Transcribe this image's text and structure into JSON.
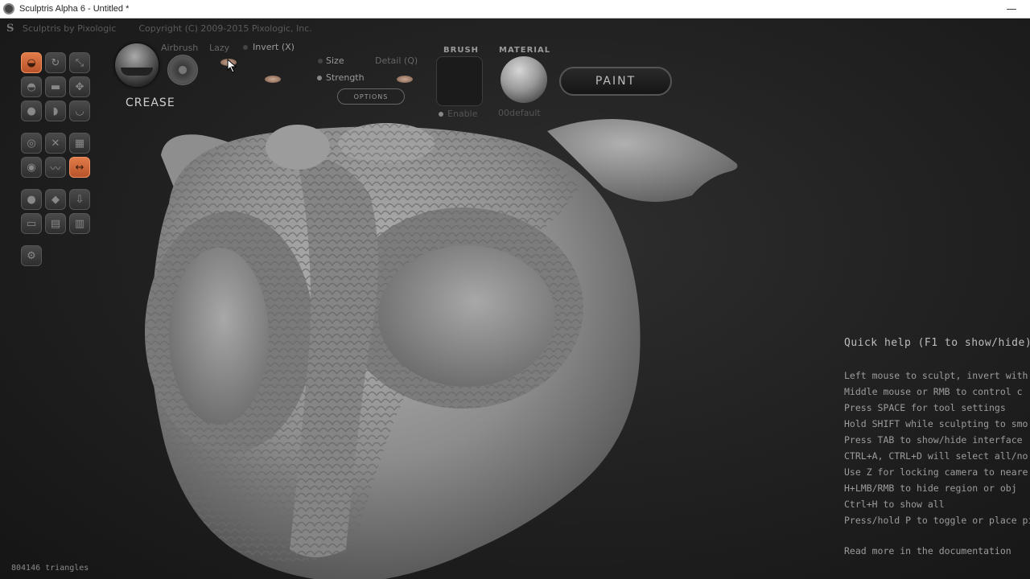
{
  "window": {
    "title": "Sculptris Alpha 6 - Untitled *",
    "minimize_glyph": "—"
  },
  "header": {
    "brand": "Sculptris by Pixologic",
    "copyright": "Copyright (C) 2009-2015 Pixologic, Inc.",
    "logo_glyph": "S"
  },
  "toolbar": {
    "tools": [
      {
        "name": "crease-tool-icon",
        "active": true
      },
      {
        "name": "rotate-tool-icon",
        "active": false
      },
      {
        "name": "scale-tool-icon",
        "active": false
      },
      {
        "name": "draw-tool-icon",
        "active": false
      },
      {
        "name": "flatten-tool-icon",
        "active": false
      },
      {
        "name": "grab-tool-icon",
        "active": false
      },
      {
        "name": "inflate-tool-icon",
        "active": false
      },
      {
        "name": "pinch-tool-icon",
        "active": false
      },
      {
        "name": "smooth-tool-icon",
        "active": false
      },
      {
        "name": "reduce-tool-icon",
        "active": false
      },
      {
        "name": "mask-tool-icon",
        "active": false
      },
      {
        "name": "grid-tool-icon",
        "active": false
      },
      {
        "name": "target-tool-icon",
        "active": false
      },
      {
        "name": "wave-tool-icon",
        "active": false
      },
      {
        "name": "symmetry-tool-icon",
        "active": true
      },
      {
        "name": "sphere-tool-icon",
        "active": false
      },
      {
        "name": "plane-tool-icon",
        "active": false
      },
      {
        "name": "import-tool-icon",
        "active": false
      },
      {
        "name": "export-tool-icon",
        "active": false
      },
      {
        "name": "save-tool-icon",
        "active": false
      },
      {
        "name": "open-tool-icon",
        "active": false
      },
      {
        "name": "settings-tool-icon",
        "active": false
      }
    ]
  },
  "brush": {
    "name": "CREASE",
    "airbrush_label": "Airbrush",
    "lazy_label": "Lazy",
    "invert_label": "Invert (X)",
    "size_label": "Size",
    "detail_label": "Detail (Q)",
    "strength_label": "Strength",
    "options_label": "OPTIONS"
  },
  "brush_slot": {
    "heading": "BRUSH",
    "value": "Enable"
  },
  "material": {
    "heading": "MATERIAL",
    "value": "00default"
  },
  "paint_button": "PAINT",
  "quick_help": {
    "title": "Quick help (F1 to show/hide)",
    "lines": [
      "Left mouse to sculpt, invert with",
      "Middle mouse or RMB to control c",
      "Press SPACE for tool settings",
      "Hold SHIFT while sculpting to smo",
      "Press TAB to show/hide interface",
      "CTRL+A, CTRL+D will select all/no",
      "Use Z for locking camera to neare",
      "H+LMB/RMB to hide region or obj",
      "Ctrl+H to show all",
      "Press/hold P to toggle or place pi"
    ],
    "footer": "Read more in the documentation"
  },
  "status": {
    "triangles": "804146 triangles"
  },
  "colors": {
    "accent": "#d9683a",
    "background": "#1a1a1a",
    "model": "#9a9a9a"
  }
}
